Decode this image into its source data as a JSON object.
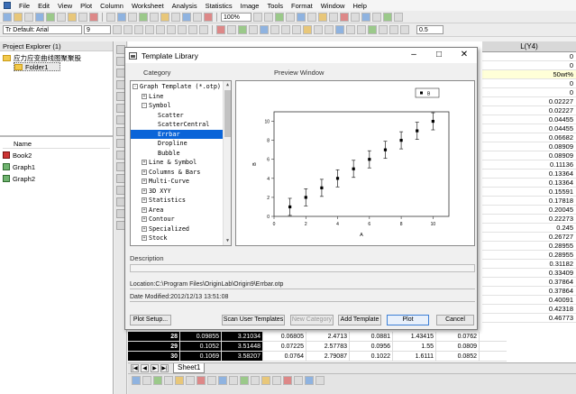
{
  "menubar": {
    "items": [
      "File",
      "Edit",
      "View",
      "Plot",
      "Column",
      "Worksheet",
      "Analysis",
      "Statistics",
      "Image",
      "Tools",
      "Format",
      "Window",
      "Help"
    ]
  },
  "toolbar": {
    "zoom": "100%",
    "font_label": "Tr Default: Arial",
    "font_size": "9",
    "line_width": "0.5"
  },
  "project_explorer": {
    "title": "Project Explorer (1)",
    "root": "应力应变曲线图聚聚股",
    "folder": "Folder1",
    "list_header": "Name",
    "items": [
      {
        "name": "Book2",
        "type": "book"
      },
      {
        "name": "Graph1",
        "type": "graph"
      },
      {
        "name": "Graph2",
        "type": "graph"
      }
    ]
  },
  "worksheet": {
    "column_header": "L(Y4)",
    "column_values": [
      "0",
      "0",
      "50wt%",
      "0",
      "0",
      "0.02227",
      "0.02227",
      "0.04455",
      "0.04455",
      "0.06682",
      "0.08909",
      "0.08909",
      "0.11136",
      "0.13364",
      "0.13364",
      "0.15591",
      "0.17818",
      "0.20045",
      "0.22273",
      "0.245",
      "0.26727",
      "0.28955",
      "0.28955",
      "0.31182",
      "0.33409",
      "0.37864",
      "0.37864",
      "0.40091",
      "0.42318",
      "0.46773"
    ],
    "rows": [
      {
        "n": "28",
        "a": "0.09855",
        "b": "3.21034",
        "c": "0.06805",
        "d": "2.4713",
        "e": "0.0881",
        "f": "1.43415",
        "g": "0.0762"
      },
      {
        "n": "29",
        "a": "0.1052",
        "b": "3.51448",
        "c": "0.07225",
        "d": "2.57783",
        "e": "0.0956",
        "f": "1.55",
        "g": "0.0809"
      },
      {
        "n": "30",
        "a": "0.1069",
        "b": "3.58207",
        "c": "0.0764",
        "d": "2.79087",
        "e": "0.1022",
        "f": "1.6111",
        "g": "0.0852"
      }
    ],
    "sheet_tab": "Sheet1"
  },
  "dialog": {
    "title": "Template Library",
    "category_label": "Category",
    "preview_label": "Preview Window",
    "tree": [
      {
        "label": "Graph Template (*.otp)",
        "level": 0,
        "box": "-"
      },
      {
        "label": "Line",
        "level": 1,
        "box": "+"
      },
      {
        "label": "Symbol",
        "level": 1,
        "box": "-"
      },
      {
        "label": "Scatter",
        "level": 2,
        "box": ""
      },
      {
        "label": "ScatterCentral",
        "level": 2,
        "box": ""
      },
      {
        "label": "Errbar",
        "level": 2,
        "box": "",
        "selected": true
      },
      {
        "label": "Dropline",
        "level": 2,
        "box": ""
      },
      {
        "label": "Bubble",
        "level": 2,
        "box": ""
      },
      {
        "label": "Line & Symbol",
        "level": 1,
        "box": "+"
      },
      {
        "label": "Columns & Bars",
        "level": 1,
        "box": "+"
      },
      {
        "label": "Multi-Curve",
        "level": 1,
        "box": "+"
      },
      {
        "label": "3D XYY",
        "level": 1,
        "box": "+"
      },
      {
        "label": "Statistics",
        "level": 1,
        "box": "+"
      },
      {
        "label": "Area",
        "level": 1,
        "box": "+"
      },
      {
        "label": "Contour",
        "level": 1,
        "box": "+"
      },
      {
        "label": "Specialized",
        "level": 1,
        "box": "+"
      },
      {
        "label": "Stock",
        "level": 1,
        "box": "+"
      }
    ],
    "description_label": "Description",
    "location": "Location:C:\\Program Files\\OriginLab\\Origin9\\Errbar.otp",
    "date_modified": "Date Modified:2012/12/13 13:51:08",
    "buttons": {
      "plot_setup": "Plot Setup...",
      "scan": "Scan User Templates",
      "new_category": "New Category",
      "add_template": "Add Template",
      "plot": "Plot",
      "cancel": "Cancel"
    }
  },
  "chart_data": {
    "type": "scatter",
    "x": [
      1,
      2,
      3,
      4,
      5,
      6,
      7,
      8,
      9,
      10
    ],
    "y": [
      1,
      2,
      3,
      4,
      5,
      6,
      7,
      8,
      9,
      10
    ],
    "error": [
      0.9,
      0.9,
      0.9,
      0.9,
      0.9,
      0.9,
      0.9,
      0.9,
      0.9,
      0.9
    ],
    "xlim": [
      0,
      11
    ],
    "ylim": [
      0,
      11
    ],
    "xticks": [
      "0",
      "2",
      "4",
      "6",
      "8",
      "10"
    ],
    "yticks": [
      "0",
      "2",
      "4",
      "6",
      "8",
      "10"
    ],
    "xlabel": "A",
    "ylabel": "B",
    "legend": "B",
    "legend_position": "top-right"
  }
}
